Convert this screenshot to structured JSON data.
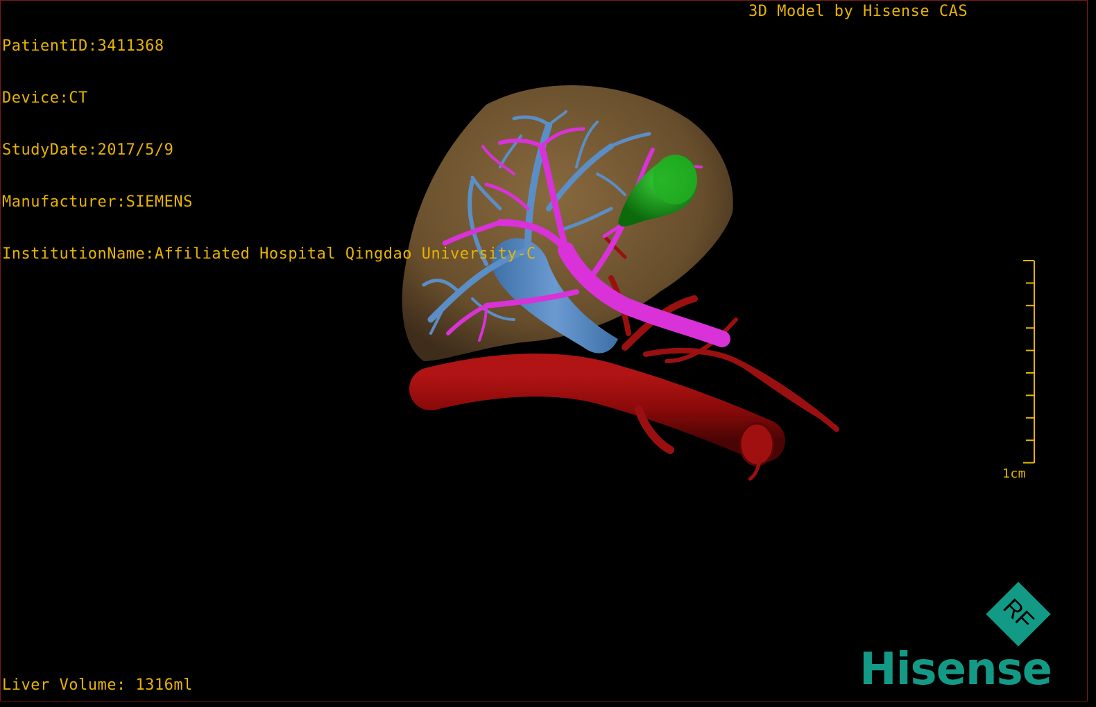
{
  "dicom_info": {
    "patient_id": "PatientID:3411368",
    "device": "Device:CT",
    "study_date": "StudyDate:2017/5/9",
    "manufacturer": "Manufacturer:SIEMENS",
    "institution": "InstitutionName:Affiliated Hospital Qingdao University-C"
  },
  "watermark_title": "3D Model by Hisense CAS",
  "liver_volume": "Liver Volume: 1316ml",
  "scale": {
    "label": "1cm"
  },
  "badge": {
    "text": "RF"
  },
  "brand": "Hisense",
  "colors": {
    "overlay_text": "#e8b400",
    "liver": "#8a6a3e",
    "portal_vein": "#d832d8",
    "hepatic_vein": "#5b8ec6",
    "gallbladder": "#1a9a1a",
    "artery": "#8c0a0a",
    "brand": "#139a86"
  },
  "model_structures": [
    "liver",
    "hepatic-vein",
    "portal-vein",
    "gallbladder",
    "aorta"
  ]
}
